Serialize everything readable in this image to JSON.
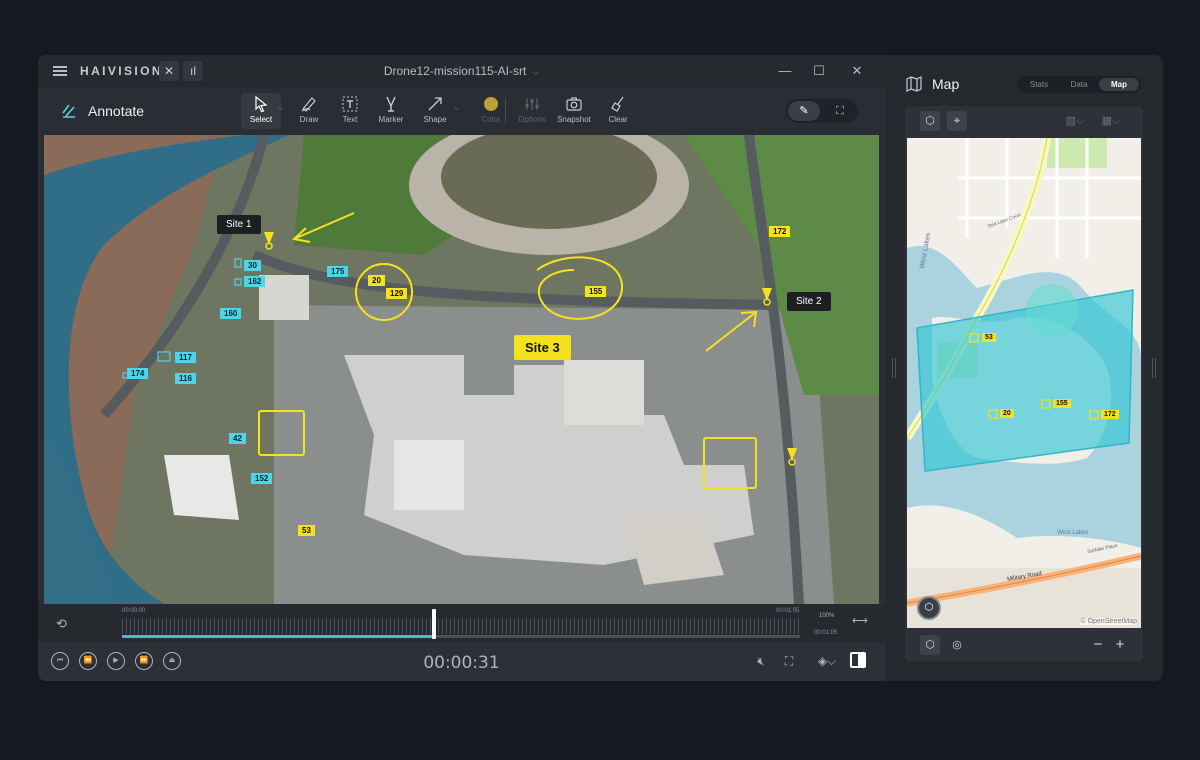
{
  "app": {
    "brand": "HAIVISION",
    "window_title": "Drone12-mission115-AI-srt"
  },
  "toolbar": {
    "section_label": "Annotate",
    "tools": [
      {
        "label": "Select"
      },
      {
        "label": "Draw"
      },
      {
        "label": "Text"
      },
      {
        "label": "Marker"
      },
      {
        "label": "Shape"
      },
      {
        "label": "Color"
      },
      {
        "label": "Options"
      },
      {
        "label": "Snapshot"
      },
      {
        "label": "Clear"
      }
    ],
    "color_swatch": "#b8a23a"
  },
  "video": {
    "site_labels": [
      "Site 1",
      "Site 2",
      "Site 3"
    ],
    "yellow_tags": [
      "172",
      "20",
      "129",
      "155",
      "53"
    ],
    "cyan_tags": [
      "175",
      "30",
      "162",
      "160",
      "117",
      "174",
      "116",
      "42",
      "152"
    ],
    "annotation_color": "#f5e21f",
    "tag_cyan": "#4fd3e6"
  },
  "scrubber": {
    "start": "00:00:00",
    "end_top": "00:01:05",
    "end_bottom": "00:01:05",
    "zoom": "100%",
    "progress": 0.46
  },
  "playback": {
    "timecode": "00:00:31"
  },
  "panel": {
    "title": "Map",
    "tabs": [
      "Stats",
      "Data",
      "Map"
    ],
    "active_tab": "Map",
    "map_tags": [
      "53",
      "20",
      "155",
      "172"
    ],
    "attribution": "© OpenStreetMap",
    "zoom_minus": "−",
    "zoom_plus": "+"
  },
  "map_labels": {
    "west_lakes_1": "West Lakes",
    "sea_lake": "Sea Lake Court",
    "military_road": "Military Road",
    "west_lakes_2": "West Lakes",
    "surf_lake": "Surfake Place"
  }
}
